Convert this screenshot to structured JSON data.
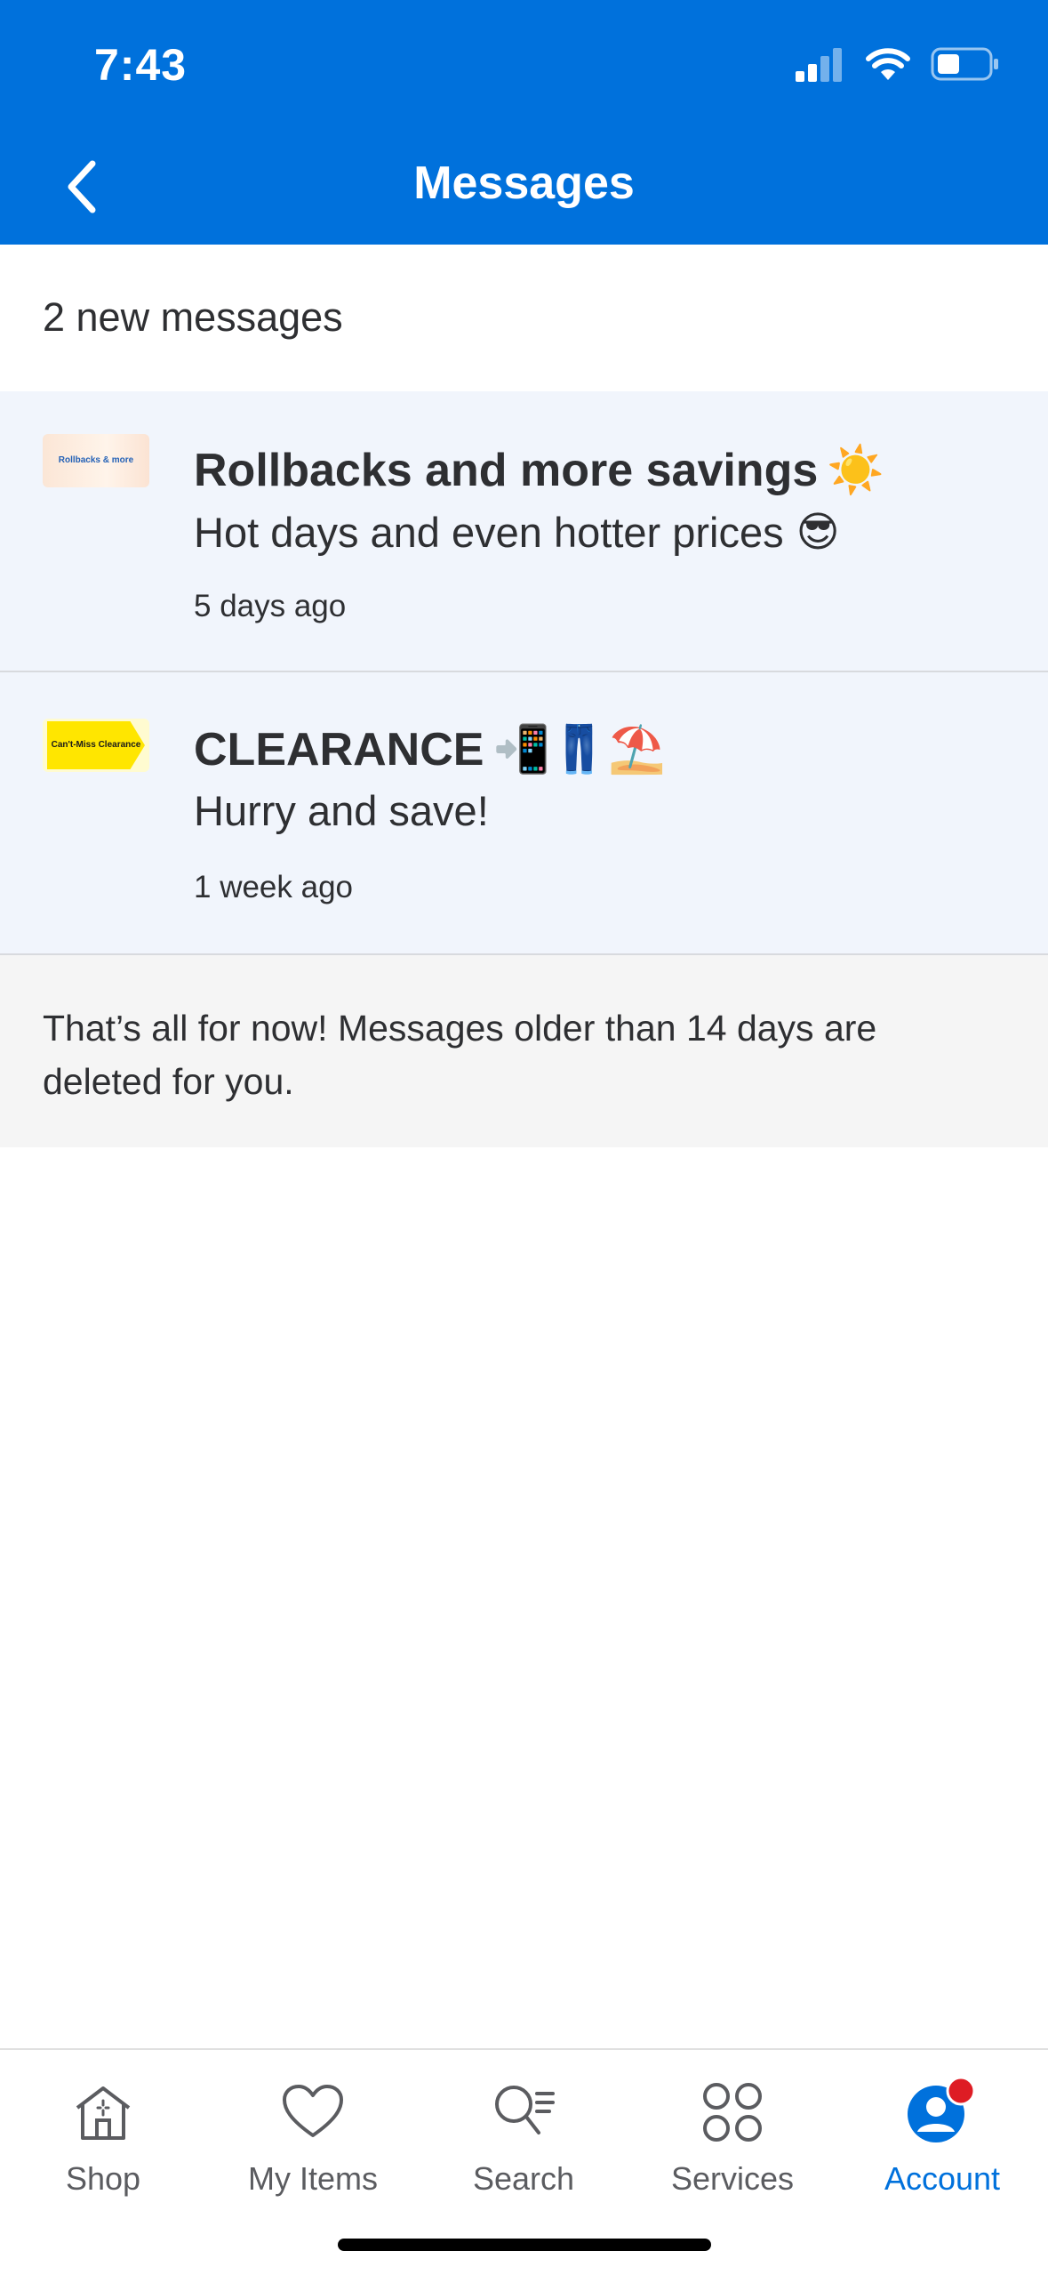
{
  "status_bar": {
    "time": "7:43"
  },
  "header": {
    "title": "Messages"
  },
  "count": {
    "text": "2 new messages"
  },
  "messages": [
    {
      "thumb_text": "Rollbacks & more",
      "title": "Rollbacks and more savings",
      "title_emoji": "☀️",
      "body": "Hot days and even hotter prices",
      "body_emoji": "😎",
      "time": "5 days ago"
    },
    {
      "thumb_text": "Can't-Miss Clearance",
      "title": "CLEARANCE",
      "title_emoji": "📲👖⛱️",
      "body": "Hurry and save!",
      "body_emoji": "",
      "time": "1 week ago"
    }
  ],
  "note": {
    "text": "That’s all for now! Messages older than 14 days are deleted for you."
  },
  "tabs": [
    {
      "label": "Shop",
      "icon": "shop-icon"
    },
    {
      "label": "My Items",
      "icon": "heart-icon"
    },
    {
      "label": "Search",
      "icon": "search-icon"
    },
    {
      "label": "Services",
      "icon": "services-icon"
    },
    {
      "label": "Account",
      "icon": "account-icon"
    }
  ],
  "colors": {
    "brand_blue": "#0071dc",
    "message_bg": "#f1f5fc",
    "badge_red": "#de1c24",
    "clearance_yellow": "#ffe600"
  }
}
